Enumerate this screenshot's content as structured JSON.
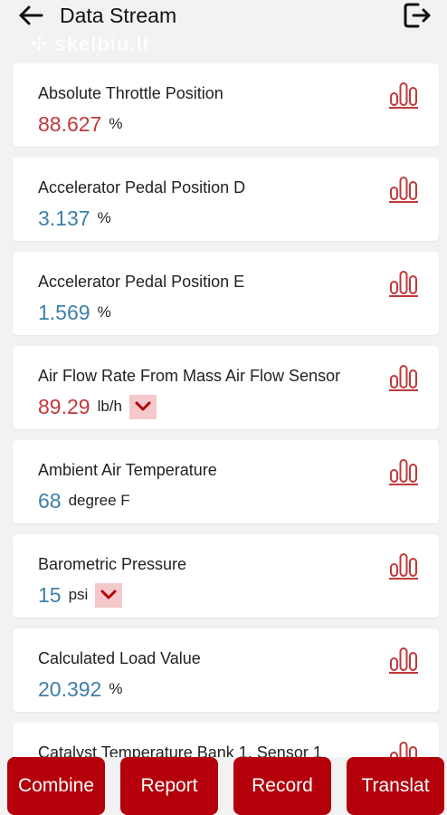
{
  "header": {
    "title": "Data Stream",
    "watermark": "skelbiu.lt"
  },
  "colors": {
    "red_value": "#c0393b",
    "blue_value": "#3d7fa8",
    "accent": "#b3000b"
  },
  "items": [
    {
      "name": "Absolute Throttle Position",
      "value": "88.627",
      "unit": "%",
      "value_color": "red",
      "has_dropdown": false
    },
    {
      "name": "Accelerator Pedal Position D",
      "value": "3.137",
      "unit": "%",
      "value_color": "blue",
      "has_dropdown": false
    },
    {
      "name": "Accelerator Pedal Position E",
      "value": "1.569",
      "unit": "%",
      "value_color": "blue",
      "has_dropdown": false
    },
    {
      "name": "Air Flow Rate From Mass Air Flow Sensor",
      "value": "89.29",
      "unit": "lb/h",
      "value_color": "red",
      "has_dropdown": true
    },
    {
      "name": "Ambient Air Temperature",
      "value": "68",
      "unit": "degree F",
      "value_color": "blue",
      "has_dropdown": false
    },
    {
      "name": "Barometric Pressure",
      "value": "15",
      "unit": "psi",
      "value_color": "blue",
      "has_dropdown": true
    },
    {
      "name": "Calculated Load Value",
      "value": "20.392",
      "unit": "%",
      "value_color": "blue",
      "has_dropdown": false
    },
    {
      "name": "Catalyst Temperature Bank 1, Sensor 1",
      "value": "",
      "unit": "",
      "value_color": "blue",
      "has_dropdown": false
    }
  ],
  "bottom_buttons": {
    "combine": "Combine",
    "report": "Report",
    "record": "Record",
    "translate": "Translat"
  }
}
